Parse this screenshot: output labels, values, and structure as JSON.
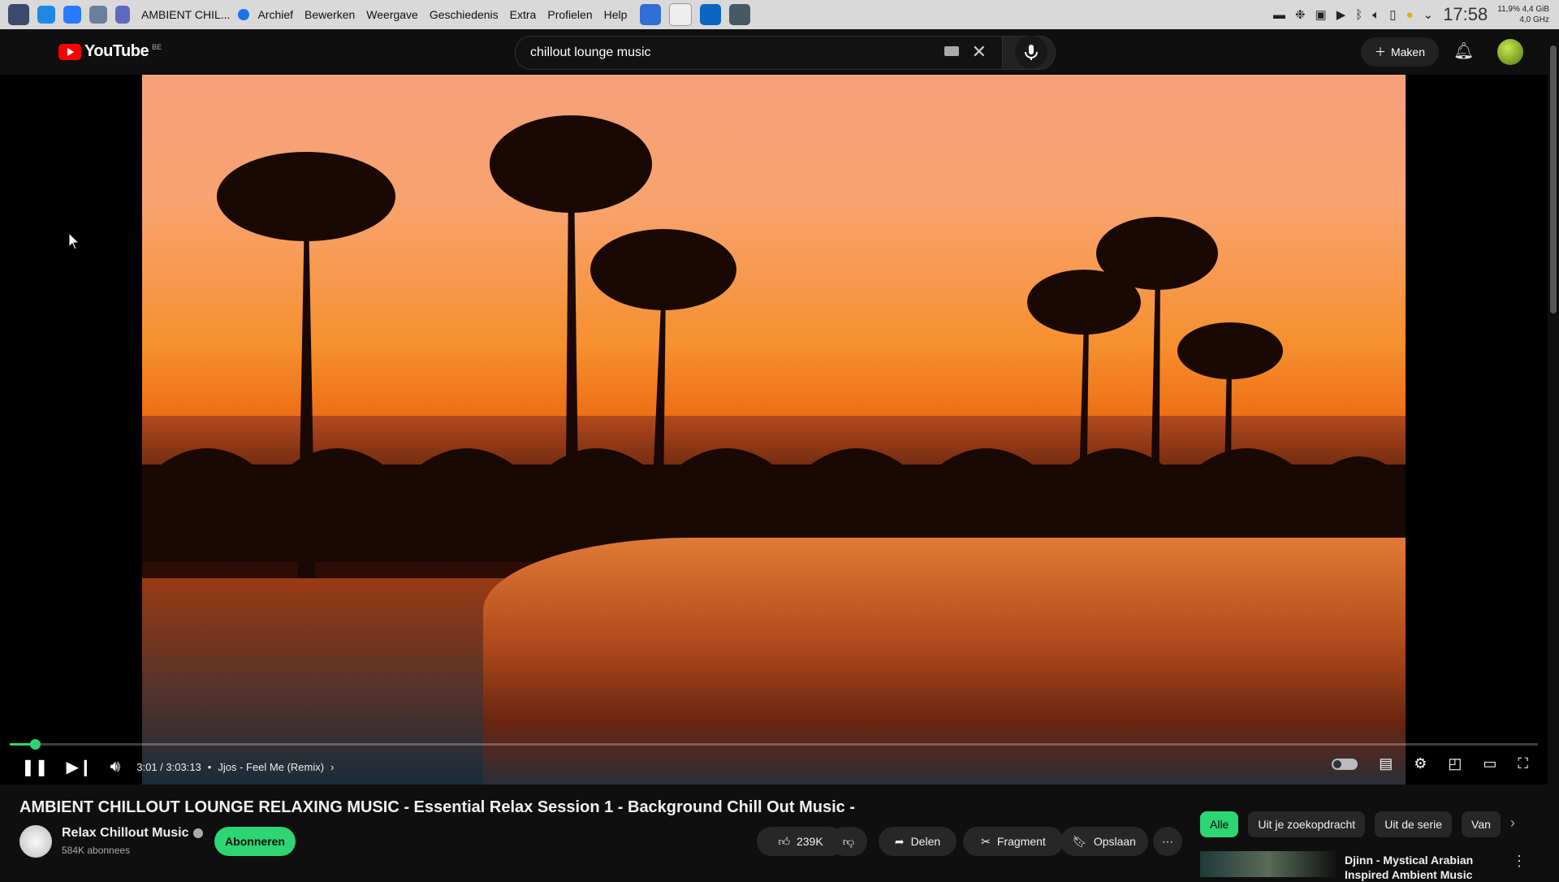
{
  "os_bar": {
    "window_title": "AMBIENT CHIL...",
    "menu": [
      "Archief",
      "Bewerken",
      "Weergave",
      "Geschiedenis",
      "Extra",
      "Profielen",
      "Help"
    ],
    "clock": "17:58",
    "sys_line1": "11,9%  4,4 GiB",
    "sys_line2": "4,0 GHz"
  },
  "header": {
    "logo": "YouTube",
    "country": "BE",
    "search_value": "chillout lounge music",
    "create_label": "Maken"
  },
  "player": {
    "progress_fraction": 0.0165,
    "time": "3:01 / 3:03:13",
    "chapter": "Jjos - Feel Me (Remix)",
    "accent": "#2ed573"
  },
  "video": {
    "title": "AMBIENT CHILLOUT LOUNGE RELAXING MUSIC - Essential Relax Session 1 - Background Chill Out Music -",
    "channel": "Relax Chillout Music",
    "subscribers": "584K abonnees",
    "subscribe_label": "Abonneren",
    "likes": "239K",
    "share_label": "Delen",
    "clip_label": "Fragment",
    "save_label": "Opslaan"
  },
  "chips": [
    "Alle",
    "Uit je zoekopdracht",
    "Uit de serie",
    "Van"
  ],
  "recommendation": {
    "title": "Djinn - Mystical Arabian Inspired Ambient Music"
  }
}
